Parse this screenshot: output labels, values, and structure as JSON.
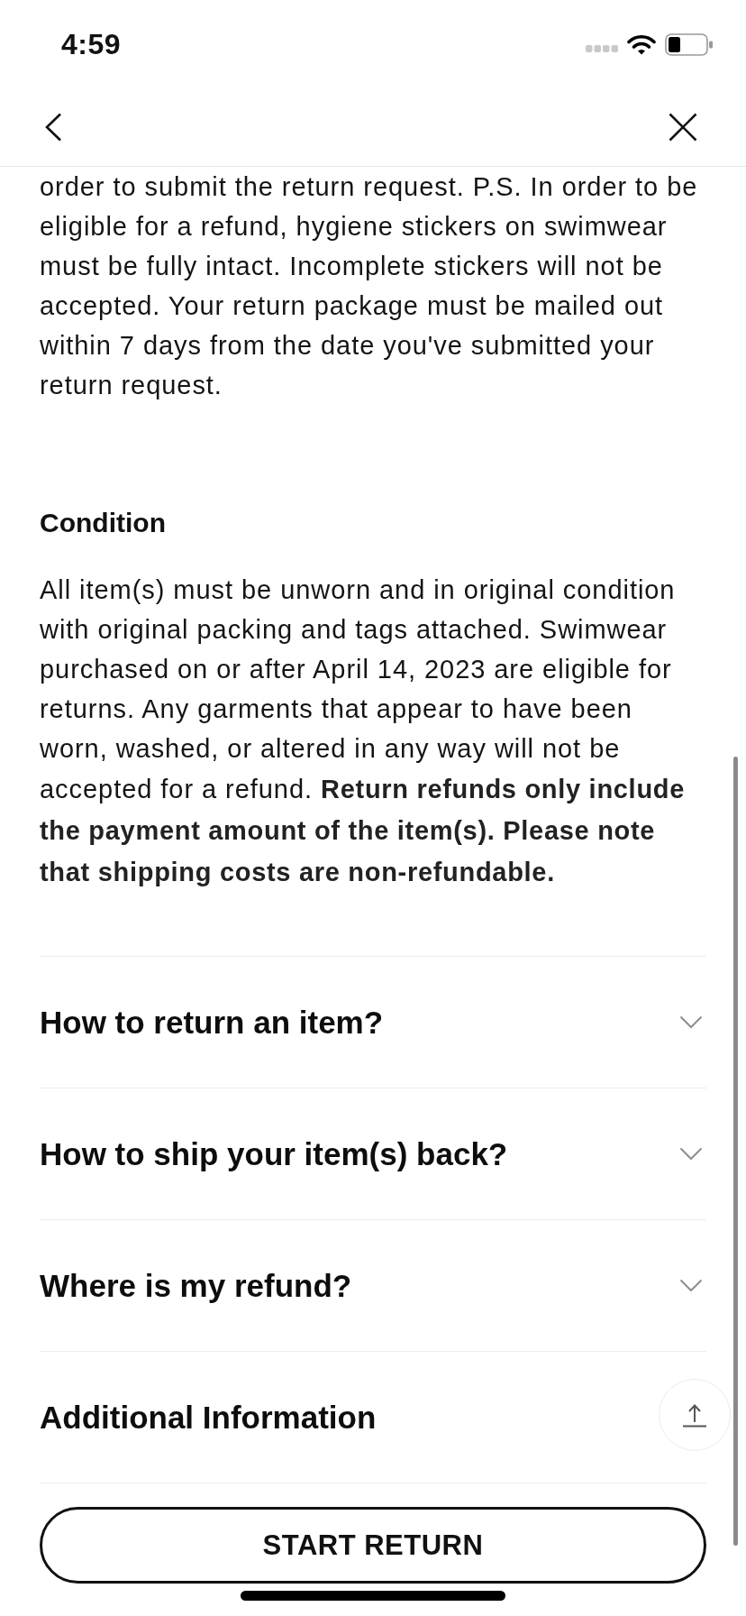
{
  "status_bar": {
    "time": "4:59"
  },
  "policy": {
    "intro_text": "order to submit the return request. P.S. In order to be eligible for a refund, hygiene stickers on swimwear must be fully intact. Incomplete stickers will not be accepted. Your return package must be mailed out within 7 days from the date you've submitted your return request.",
    "sections": [
      {
        "heading": "Condition",
        "body": "All item(s) must be unworn and in original condition with original packing and tags attached. Swimwear purchased on or after April 14, 2023 are eligible for returns. Any garments that appear to have been worn, washed, or altered in any way will not be accepted for a refund. **Return refunds only include the payment amount of the item(s). Please note that shipping costs are non-refundable.**"
      }
    ]
  },
  "faq": [
    {
      "title": "How to return an item?",
      "kind": "accordion",
      "expanded": false
    },
    {
      "title": "How to ship your item(s) back?",
      "kind": "accordion",
      "expanded": false
    },
    {
      "title": "Where is my refund?",
      "kind": "accordion",
      "expanded": false
    },
    {
      "title": "Additional Information",
      "kind": "section"
    }
  ],
  "primary_button": {
    "label": "START RETURN"
  }
}
